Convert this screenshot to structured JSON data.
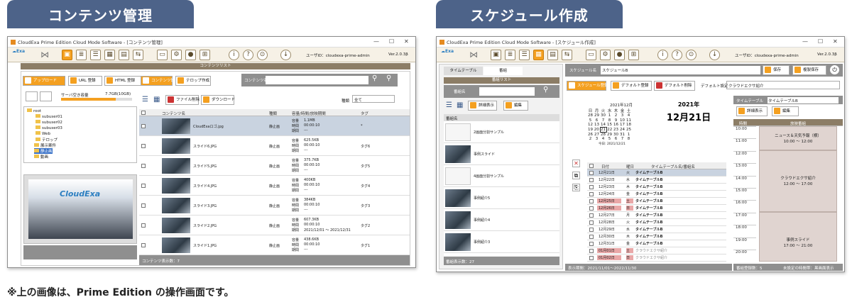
{
  "banners": {
    "left": "コンテンツ管理",
    "right": "スケジュール作成"
  },
  "footnote": "※上の画像は、Prime Edition の操作画面です。",
  "left_window": {
    "title": "CloudExa Prime Edition Cloud Mode Software - [コンテンツ管理]",
    "user": "ユーザID：cloudexa-prime-admin",
    "version": "Ver.2.0.3β",
    "list_header": "コンテンツリスト",
    "upload_btn": "アップロード",
    "url_btn": "URL 登録",
    "html_btn": "HTML 登録",
    "content_set_btn": "コンテンツ設定",
    "telop_btn": "テロップ作成",
    "search_label": "コンテンツ名",
    "server_label": "サーバ空き容量",
    "server_value": "7.7GB(10GB)",
    "file_delete": "ファイル削除",
    "download": "ダウンロード",
    "type_label": "種類",
    "type_value": "全て",
    "tree": [
      "root",
      "subuser01",
      "subuser02",
      "subuser03",
      "Web",
      "テロップ",
      "展示案件",
      "静止画",
      "動画"
    ],
    "columns": {
      "name": "コンテンツ名",
      "type": "種類",
      "info": "容量/時間/放映期間",
      "tag": "タグ"
    },
    "rows": [
      {
        "name": "CloudExaロゴ.jpg",
        "type": "静止画",
        "size": "1.1MB",
        "time": "00:00:10",
        "period": "---",
        "tag": "*"
      },
      {
        "name": "スライド6.JPG",
        "type": "静止画",
        "size": "625.5KB",
        "time": "00:00:10",
        "period": "---",
        "tag": "タグ6"
      },
      {
        "name": "スライド5.JPG",
        "type": "静止画",
        "size": "375.7KB",
        "time": "00:00:10",
        "period": "---",
        "tag": "タグ5"
      },
      {
        "name": "スライド4.JPG",
        "type": "静止画",
        "size": "400KB",
        "time": "00:00:10",
        "period": "---",
        "tag": "タグ4"
      },
      {
        "name": "スライド3.JPG",
        "type": "静止画",
        "size": "384KB",
        "time": "00:00:10",
        "period": "---",
        "tag": "タグ3"
      },
      {
        "name": "スライド2.JPG",
        "type": "静止画",
        "size": "607.3KB",
        "time": "00:00:10",
        "period": "2021/12/01 ～ 2021/12/31",
        "tag": "タグ2"
      },
      {
        "name": "スライド1.JPG",
        "type": "静止画",
        "size": "438.6KB",
        "time": "00:00:10",
        "period": "---",
        "tag": "タグ1"
      }
    ],
    "info_labels": {
      "size": "容量",
      "time": "時間",
      "period": "期間"
    },
    "count": "コンテンツ表示数：7",
    "preview_logo": "CloudExa"
  },
  "right_window": {
    "title": "CloudExa Prime Edition Cloud Mode Software - [スケジュール作成]",
    "user": "ユーザID：cloudexa-prime-admin",
    "version": "Ver.2.0.3β",
    "tabs": [
      "タイムテーブル",
      "番組"
    ],
    "program_list": "番組リスト",
    "program_name_label": "番組名",
    "detail_btn": "詳細表示",
    "edit_btn": "編集",
    "programs": [
      "2画面分割サンプル",
      "事例スライド",
      "4画面分割サンプル",
      "事例紹介5",
      "事例紹介4",
      "事例紹介3"
    ],
    "program_count": "番組表示数：27",
    "schedule_name_label": "スケジュール名",
    "schedule_name": "スケジュールB",
    "save": "保存",
    "copy_save": "複製保存",
    "sched_reg": "スケジュール登録",
    "default_reg": "デフォルト登録",
    "default_del": "デフォルト削除",
    "default_setting": "デフォルト設定",
    "default_value": "クラウドエクサ紹介",
    "cal_month": "2021年12月",
    "cal_weekdays": [
      "日",
      "月",
      "火",
      "水",
      "木",
      "金",
      "土"
    ],
    "cal_rows": [
      [
        "28",
        "29",
        "30",
        "1",
        "2",
        "3",
        "4"
      ],
      [
        "5",
        "6",
        "7",
        "8",
        "9",
        "10",
        "11"
      ],
      [
        "12",
        "13",
        "14",
        "15",
        "16",
        "17",
        "18"
      ],
      [
        "19",
        "20",
        "21",
        "22",
        "23",
        "24",
        "25"
      ],
      [
        "26",
        "27",
        "28",
        "29",
        "30",
        "31",
        "1"
      ],
      [
        "2",
        "3",
        "4",
        "5",
        "6",
        "7",
        "8"
      ]
    ],
    "cal_today": "今日: 2021/12/21",
    "big_year": "2021年",
    "big_date": "12月21日",
    "date_cols": {
      "date": "日付",
      "wd": "曜日",
      "tt": "タイムテーブル名/番組名"
    },
    "date_rows": [
      {
        "d": "12月21日",
        "w": "火",
        "t": "タイムテーブルB"
      },
      {
        "d": "12月22日",
        "w": "水",
        "t": "タイムテーブルB"
      },
      {
        "d": "12月23日",
        "w": "木",
        "t": "タイムテーブルB"
      },
      {
        "d": "12月24日",
        "w": "金",
        "t": "タイムテーブルB"
      },
      {
        "d": "12月25日",
        "w": "土",
        "t": "タイムテーブルB"
      },
      {
        "d": "12月26日",
        "w": "日",
        "t": "タイムテーブルB"
      },
      {
        "d": "12月27日",
        "w": "月",
        "t": "タイムテーブルB"
      },
      {
        "d": "12月28日",
        "w": "火",
        "t": "タイムテーブルB"
      },
      {
        "d": "12月29日",
        "w": "水",
        "t": "タイムテーブルB"
      },
      {
        "d": "12月30日",
        "w": "木",
        "t": "タイムテーブルB"
      },
      {
        "d": "12月31日",
        "w": "金",
        "t": "タイムテーブルB"
      },
      {
        "d": "01月01日",
        "w": "土",
        "t": "クラウドエクサ紹介"
      },
      {
        "d": "01月02日",
        "w": "日",
        "t": "クラウドエクサ紹介"
      }
    ],
    "period_text": "表示期間：2021/11/01～2022/11/30",
    "tt_label": "タイムテーブル",
    "tt_value": "タイムテーブルB",
    "tt_cols": {
      "time": "時間",
      "prog": "放映番組"
    },
    "times": [
      "10:00",
      "11:00",
      "12:00",
      "13:00",
      "14:00",
      "15:00",
      "16:00",
      "17:00",
      "18:00",
      "19:00",
      "20:00"
    ],
    "block1": "ニュース＆天気予報（横）",
    "block1_time": "10:00 ～ 12:00",
    "block2": "クラウドエクサ紹介",
    "block2_time": "12:00 ～ 17:00",
    "block3": "事例スライド",
    "block3_time": "17:00 ～ 21:00",
    "prog_count": "番組登録数：5",
    "unset_text": "未設定の時間帯：黒画面表示"
  }
}
